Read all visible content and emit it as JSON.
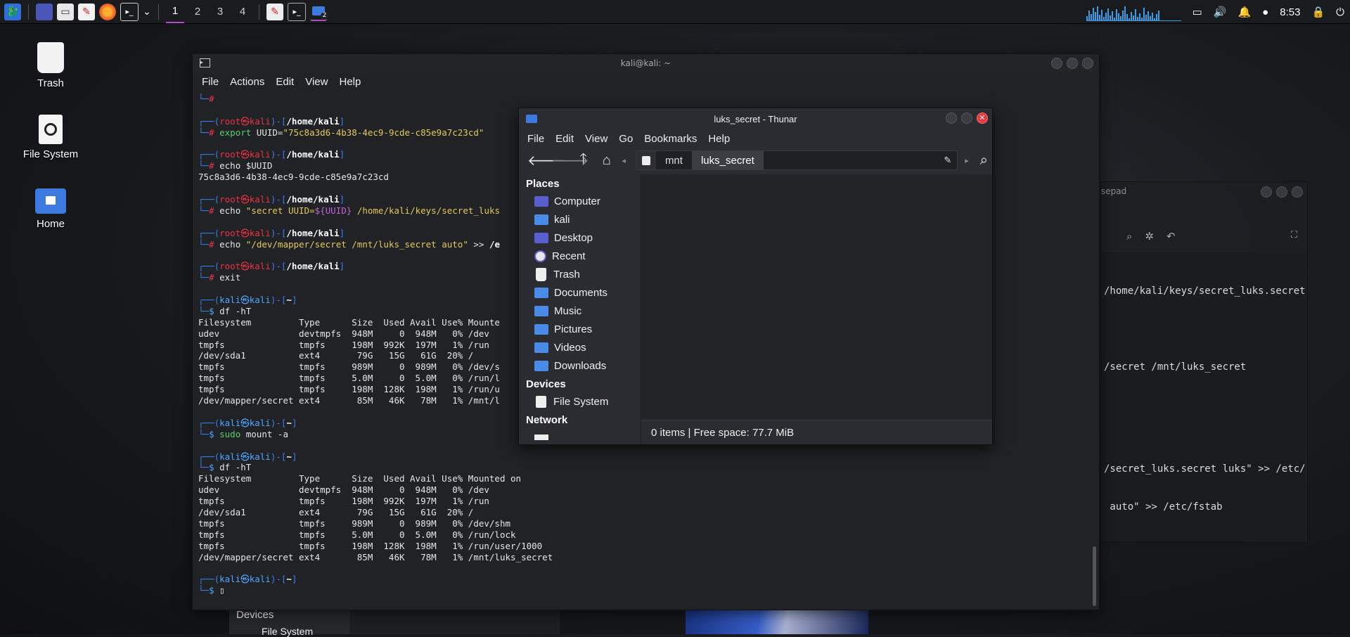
{
  "taskbar": {
    "workspaces": [
      "1",
      "2",
      "3",
      "4"
    ],
    "clock": "8:53",
    "thunar_badge": "2"
  },
  "desktop": {
    "icons": [
      "Trash",
      "File System",
      "Home"
    ]
  },
  "terminal": {
    "title": "kali@kali: ~",
    "menu": [
      "File",
      "Actions",
      "Edit",
      "View",
      "Help"
    ],
    "lines": [
      {
        "segs": [
          [
            "└─",
            "c-blue"
          ],
          [
            "#",
            "c-red"
          ]
        ]
      },
      {
        "segs": [
          [
            "",
            ""
          ]
        ]
      },
      {
        "segs": [
          [
            "┌──(",
            "c-blue"
          ],
          [
            "root㉿kali",
            "c-red"
          ],
          [
            ")-[",
            "c-blue"
          ],
          [
            "/home/kali",
            "c-white"
          ],
          [
            "]",
            "c-blue"
          ]
        ]
      },
      {
        "segs": [
          [
            "└─",
            "c-blue"
          ],
          [
            "# ",
            "c-red"
          ],
          [
            "export",
            "c-cmd"
          ],
          [
            " UUID=",
            ""
          ],
          [
            "\"75c8a3d6-4b38-4ec9-9cde-c85e9a7c23cd\"",
            "c-str"
          ]
        ]
      },
      {
        "segs": [
          [
            "",
            ""
          ]
        ]
      },
      {
        "segs": [
          [
            "┌──(",
            "c-blue"
          ],
          [
            "root㉿kali",
            "c-red"
          ],
          [
            ")-[",
            "c-blue"
          ],
          [
            "/home/kali",
            "c-white"
          ],
          [
            "]",
            "c-blue"
          ]
        ]
      },
      {
        "segs": [
          [
            "└─",
            "c-blue"
          ],
          [
            "# ",
            "c-red"
          ],
          [
            "echo $UUID",
            ""
          ]
        ]
      },
      {
        "segs": [
          [
            "75c8a3d6-4b38-4ec9-9cde-c85e9a7c23cd",
            ""
          ]
        ]
      },
      {
        "segs": [
          [
            "",
            ""
          ]
        ]
      },
      {
        "segs": [
          [
            "┌──(",
            "c-blue"
          ],
          [
            "root㉿kali",
            "c-red"
          ],
          [
            ")-[",
            "c-blue"
          ],
          [
            "/home/kali",
            "c-white"
          ],
          [
            "]",
            "c-blue"
          ]
        ]
      },
      {
        "segs": [
          [
            "└─",
            "c-blue"
          ],
          [
            "# ",
            "c-red"
          ],
          [
            "echo ",
            ""
          ],
          [
            "\"secret UUID=",
            "c-str"
          ],
          [
            "${UUID}",
            "c-var"
          ],
          [
            " /home/kali/keys/secret_luks",
            "c-str"
          ]
        ]
      },
      {
        "segs": [
          [
            "",
            ""
          ]
        ]
      },
      {
        "segs": [
          [
            "┌──(",
            "c-blue"
          ],
          [
            "root㉿kali",
            "c-red"
          ],
          [
            ")-[",
            "c-blue"
          ],
          [
            "/home/kali",
            "c-white"
          ],
          [
            "]",
            "c-blue"
          ]
        ]
      },
      {
        "segs": [
          [
            "└─",
            "c-blue"
          ],
          [
            "# ",
            "c-red"
          ],
          [
            "echo ",
            ""
          ],
          [
            "\"/dev/mapper/secret /mnt/luks_secret auto\"",
            "c-str"
          ],
          [
            " >> ",
            ""
          ],
          [
            "/e",
            "c-white"
          ]
        ]
      },
      {
        "segs": [
          [
            "",
            ""
          ]
        ]
      },
      {
        "segs": [
          [
            "┌──(",
            "c-blue"
          ],
          [
            "root㉿kali",
            "c-red"
          ],
          [
            ")-[",
            "c-blue"
          ],
          [
            "/home/kali",
            "c-white"
          ],
          [
            "]",
            "c-blue"
          ]
        ]
      },
      {
        "segs": [
          [
            "└─",
            "c-blue"
          ],
          [
            "# ",
            "c-red"
          ],
          [
            "exit",
            ""
          ]
        ]
      },
      {
        "segs": [
          [
            "",
            ""
          ]
        ]
      },
      {
        "segs": [
          [
            "┌──(",
            "c-blue"
          ],
          [
            "kali㉿kali",
            "c-grn"
          ],
          [
            ")-[",
            "c-blue"
          ],
          [
            "~",
            "c-white"
          ],
          [
            "]",
            "c-blue"
          ]
        ]
      },
      {
        "segs": [
          [
            "└─",
            "c-blue"
          ],
          [
            "$ ",
            "c-grn"
          ],
          [
            "df -hT",
            ""
          ]
        ]
      },
      {
        "segs": [
          [
            "Filesystem         Type      Size  Used Avail Use% Mounte",
            ""
          ]
        ]
      },
      {
        "segs": [
          [
            "udev               devtmpfs  948M     0  948M   0% /dev",
            ""
          ]
        ]
      },
      {
        "segs": [
          [
            "tmpfs              tmpfs     198M  992K  197M   1% /run",
            ""
          ]
        ]
      },
      {
        "segs": [
          [
            "/dev/sda1          ext4       79G   15G   61G  20% /",
            ""
          ]
        ]
      },
      {
        "segs": [
          [
            "tmpfs              tmpfs     989M     0  989M   0% /dev/s",
            ""
          ]
        ]
      },
      {
        "segs": [
          [
            "tmpfs              tmpfs     5.0M     0  5.0M   0% /run/l",
            ""
          ]
        ]
      },
      {
        "segs": [
          [
            "tmpfs              tmpfs     198M  128K  198M   1% /run/u",
            ""
          ]
        ]
      },
      {
        "segs": [
          [
            "/dev/mapper/secret ext4       85M   46K   78M   1% /mnt/l",
            ""
          ]
        ]
      },
      {
        "segs": [
          [
            "",
            ""
          ]
        ]
      },
      {
        "segs": [
          [
            "┌──(",
            "c-blue"
          ],
          [
            "kali㉿kali",
            "c-grn"
          ],
          [
            ")-[",
            "c-blue"
          ],
          [
            "~",
            "c-white"
          ],
          [
            "]",
            "c-blue"
          ]
        ]
      },
      {
        "segs": [
          [
            "└─",
            "c-blue"
          ],
          [
            "$ ",
            "c-grn"
          ],
          [
            "sudo",
            "c-cmd"
          ],
          [
            " mount -a",
            ""
          ]
        ]
      },
      {
        "segs": [
          [
            "",
            ""
          ]
        ]
      },
      {
        "segs": [
          [
            "┌──(",
            "c-blue"
          ],
          [
            "kali㉿kali",
            "c-grn"
          ],
          [
            ")-[",
            "c-blue"
          ],
          [
            "~",
            "c-white"
          ],
          [
            "]",
            "c-blue"
          ]
        ]
      },
      {
        "segs": [
          [
            "└─",
            "c-blue"
          ],
          [
            "$ ",
            "c-grn"
          ],
          [
            "df -hT",
            ""
          ]
        ]
      },
      {
        "segs": [
          [
            "Filesystem         Type      Size  Used Avail Use% Mounted on",
            ""
          ]
        ]
      },
      {
        "segs": [
          [
            "udev               devtmpfs  948M     0  948M   0% /dev",
            ""
          ]
        ]
      },
      {
        "segs": [
          [
            "tmpfs              tmpfs     198M  992K  197M   1% /run",
            ""
          ]
        ]
      },
      {
        "segs": [
          [
            "/dev/sda1          ext4       79G   15G   61G  20% /",
            ""
          ]
        ]
      },
      {
        "segs": [
          [
            "tmpfs              tmpfs     989M     0  989M   0% /dev/shm",
            ""
          ]
        ]
      },
      {
        "segs": [
          [
            "tmpfs              tmpfs     5.0M     0  5.0M   0% /run/lock",
            ""
          ]
        ]
      },
      {
        "segs": [
          [
            "tmpfs              tmpfs     198M  128K  198M   1% /run/user/1000",
            ""
          ]
        ]
      },
      {
        "segs": [
          [
            "/dev/mapper/secret ext4       85M   46K   78M   1% /mnt/luks_secret",
            ""
          ]
        ]
      },
      {
        "segs": [
          [
            "",
            ""
          ]
        ]
      },
      {
        "segs": [
          [
            "┌──(",
            "c-blue"
          ],
          [
            "kali㉿kali",
            "c-grn"
          ],
          [
            ")-[",
            "c-blue"
          ],
          [
            "~",
            "c-white"
          ],
          [
            "]",
            "c-blue"
          ]
        ]
      },
      {
        "segs": [
          [
            "└─",
            "c-blue"
          ],
          [
            "$ ",
            "c-grn"
          ],
          [
            "▯",
            ""
          ]
        ]
      }
    ]
  },
  "mousepad": {
    "title": "sepad",
    "lines": [
      "/home/kali/keys/secret_luks.secret",
      "/secret /mnt/luks_secret",
      "/secret_luks.secret luks\" >> /etc/",
      " auto\" >> /etc/fstab"
    ]
  },
  "thunar": {
    "title": "luks_secret - Thunar",
    "menu": [
      "File",
      "Edit",
      "View",
      "Go",
      "Bookmarks",
      "Help"
    ],
    "path": [
      "mnt",
      "luks_secret"
    ],
    "places_header": "Places",
    "places": [
      "Computer",
      "kali",
      "Desktop",
      "Recent",
      "Trash",
      "Documents",
      "Music",
      "Pictures",
      "Videos",
      "Downloads"
    ],
    "devices_header": "Devices",
    "devices": [
      "File System"
    ],
    "network_header": "Network",
    "status": "0 items  |  Free space: 77.7 MiB"
  },
  "behind": {
    "devices_header": "Devices",
    "file_system": "File System"
  }
}
